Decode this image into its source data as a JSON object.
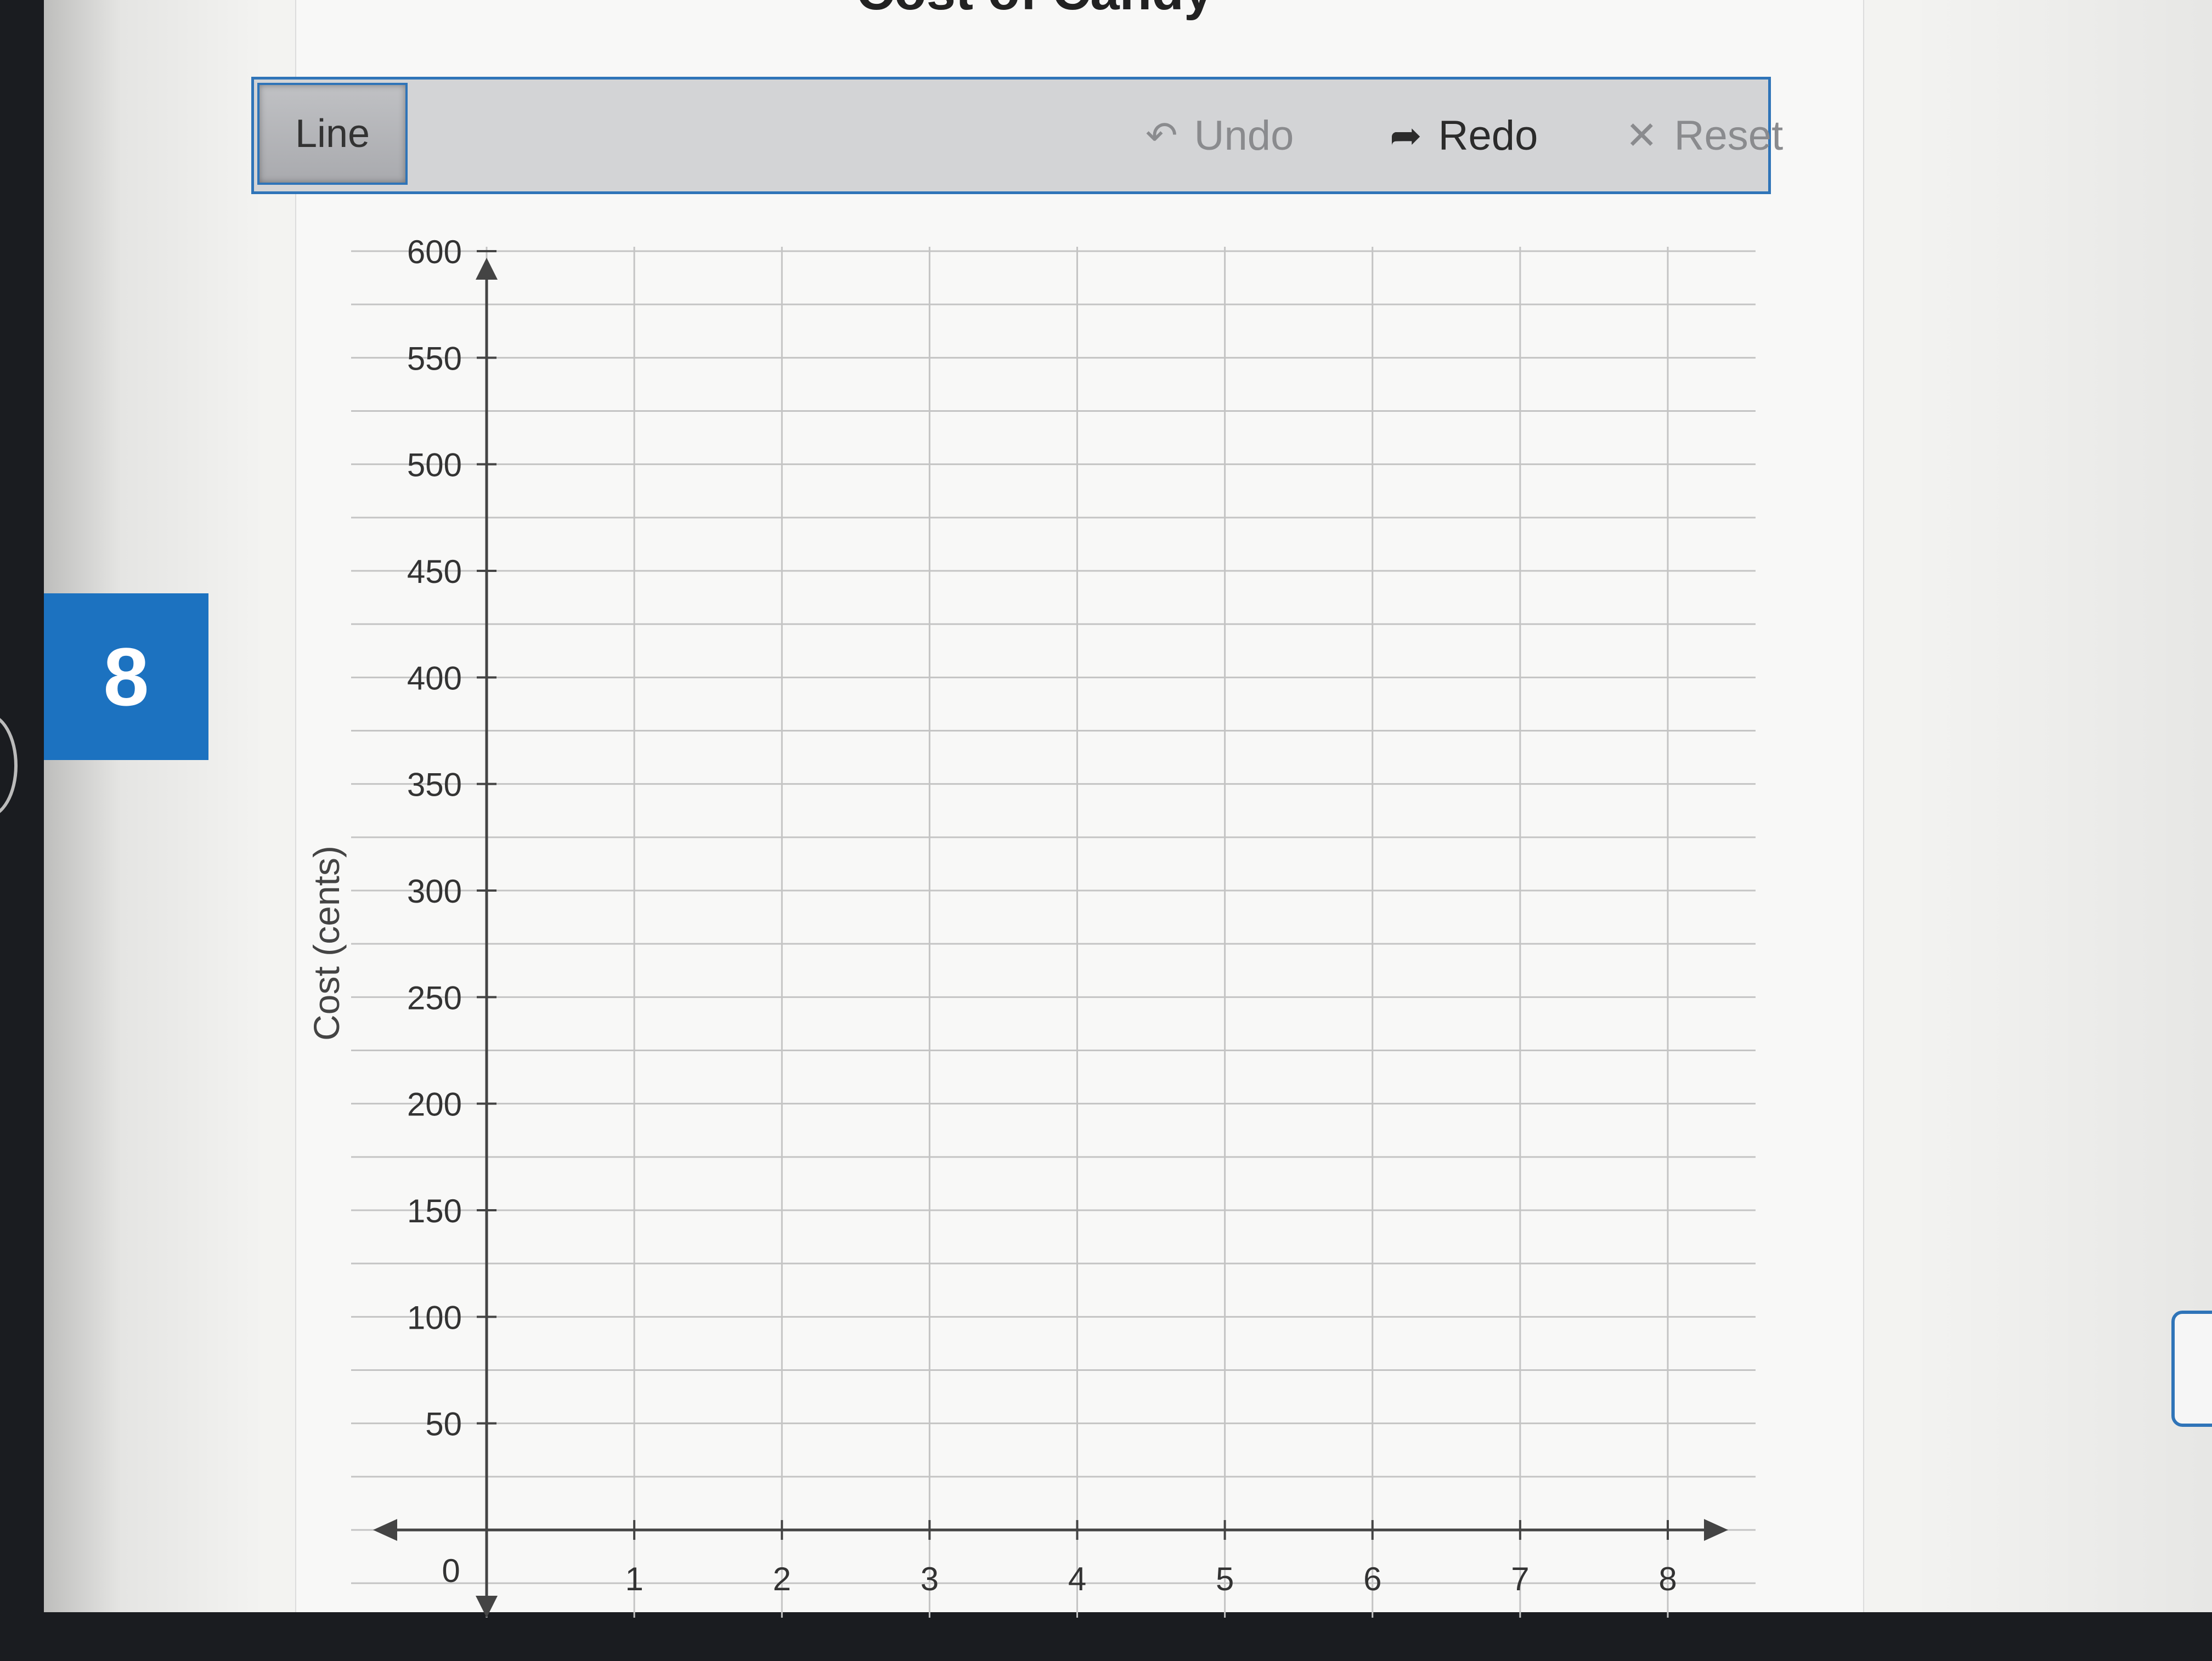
{
  "page": {
    "title": "Cost of Candy",
    "question_number": "8"
  },
  "toolbar": {
    "line_label": "Line",
    "undo_label": "Undo",
    "redo_label": "Redo",
    "reset_label": "Reset",
    "undo_icon": "undo-arrow-icon",
    "redo_icon": "redo-arrow-icon",
    "reset_icon": "close-x-icon"
  },
  "colors": {
    "accent_blue": "#1c72c0",
    "toolbar_border": "#2f74b8"
  },
  "chart_data": {
    "type": "line",
    "title": "Cost of Candy",
    "xlabel": "",
    "ylabel": "Cost (cents)",
    "x_ticks": [
      "1",
      "2",
      "3",
      "4",
      "5",
      "6",
      "7",
      "8"
    ],
    "y_ticks": [
      "50",
      "100",
      "150",
      "200",
      "250",
      "300",
      "350",
      "400",
      "450",
      "500",
      "550",
      "600"
    ],
    "origin_label": "0",
    "xlim": [
      0,
      8
    ],
    "ylim": [
      0,
      600
    ],
    "grid": true,
    "series": []
  }
}
